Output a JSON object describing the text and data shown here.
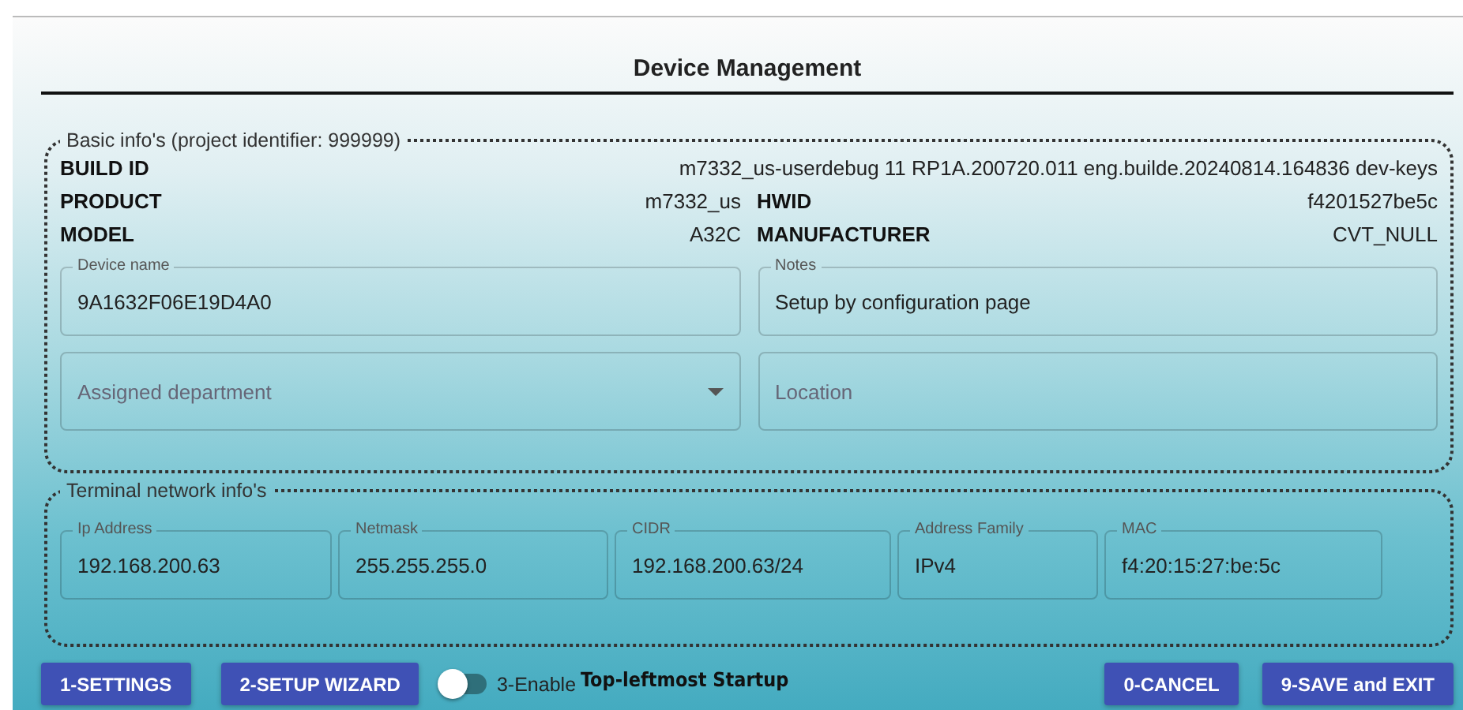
{
  "title": "Device Management",
  "basic_info": {
    "legend": "Basic info's (project identifier: 999999)",
    "build": {
      "label": "BUILD ID",
      "value": "m7332_us-userdebug 11 RP1A.200720.011 eng.builde.20240814.164836 dev-keys"
    },
    "pairs": [
      [
        {
          "label": "PRODUCT",
          "value": "m7332_us"
        },
        {
          "label": "HWID",
          "value": "f4201527be5c"
        }
      ],
      [
        {
          "label": "MODEL",
          "value": "A32C"
        },
        {
          "label": "MANUFACTURER",
          "value": "CVT_NULL"
        }
      ]
    ],
    "fields": [
      {
        "kind": "text",
        "label": "Device name",
        "value": "9A1632F06E19D4A0"
      },
      {
        "kind": "text",
        "label": "Notes",
        "value": "Setup by configuration page"
      },
      {
        "kind": "select",
        "placeholder": "Assigned department"
      },
      {
        "kind": "text",
        "placeholder": "Location"
      }
    ]
  },
  "network": {
    "legend": "Terminal network info's",
    "fields": [
      {
        "label": "Ip Address",
        "value": "192.168.200.63"
      },
      {
        "label": "Netmask",
        "value": "255.255.255.0"
      },
      {
        "label": "CIDR",
        "value": "192.168.200.63/24"
      },
      {
        "label": "Address Family",
        "value": "IPv4"
      },
      {
        "label": "MAC",
        "value": "f4:20:15:27:be:5c"
      }
    ]
  },
  "left_buttons": [
    "1-SETTINGS",
    "2-SETUP WIZARD"
  ],
  "toggle": {
    "on": false,
    "label": "3-Enable",
    "extra": "Top-leftmost Startup"
  },
  "right_buttons": [
    "0-CANCEL",
    "9-SAVE and EXIT"
  ]
}
